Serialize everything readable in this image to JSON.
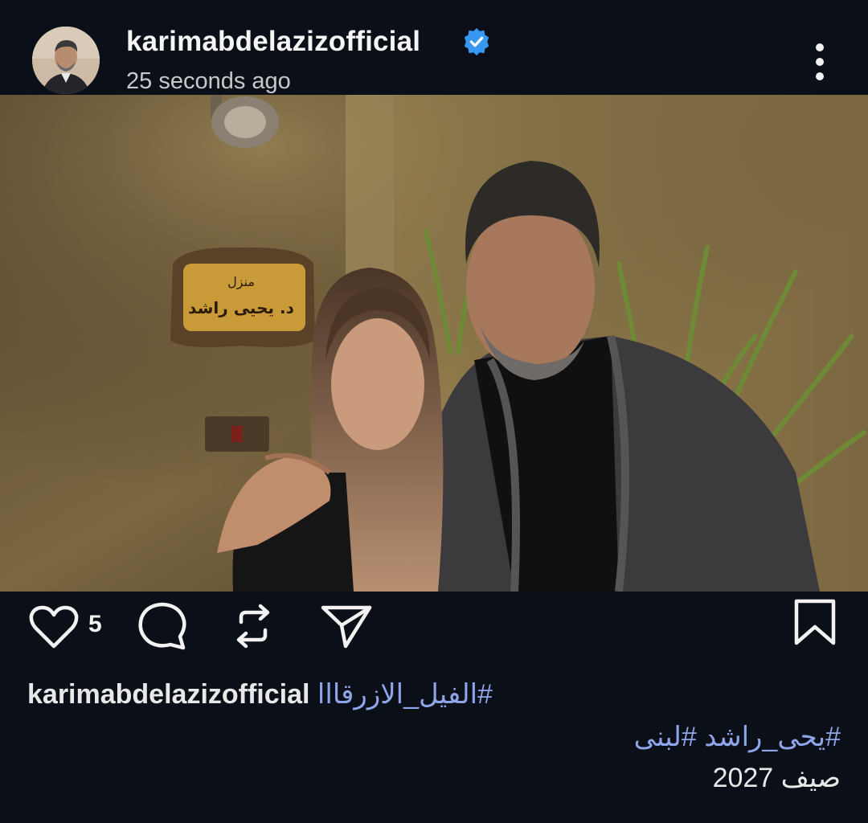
{
  "post": {
    "username": "karimabdelazizofficial",
    "verified": true,
    "timestamp": "25 seconds ago",
    "photo_sign_text_top": "منزل",
    "photo_sign_text_main": "د. يحيى راشد"
  },
  "actions": {
    "like_icon": "heart-icon",
    "like_count": "5",
    "comment_icon": "comment-bubble-icon",
    "repost_icon": "repost-icon",
    "share_icon": "send-icon",
    "save_icon": "bookmark-icon"
  },
  "caption": {
    "username": "karimabdelazizofficial",
    "tag1": "#الفيل_الازرقااا",
    "line2": "#يحى_راشد #لبنى",
    "line3": "صيف 2027"
  },
  "colors": {
    "background": "#0b0f17",
    "hashtag": "#8fa5ea",
    "verified_badge": "#3897f0"
  }
}
